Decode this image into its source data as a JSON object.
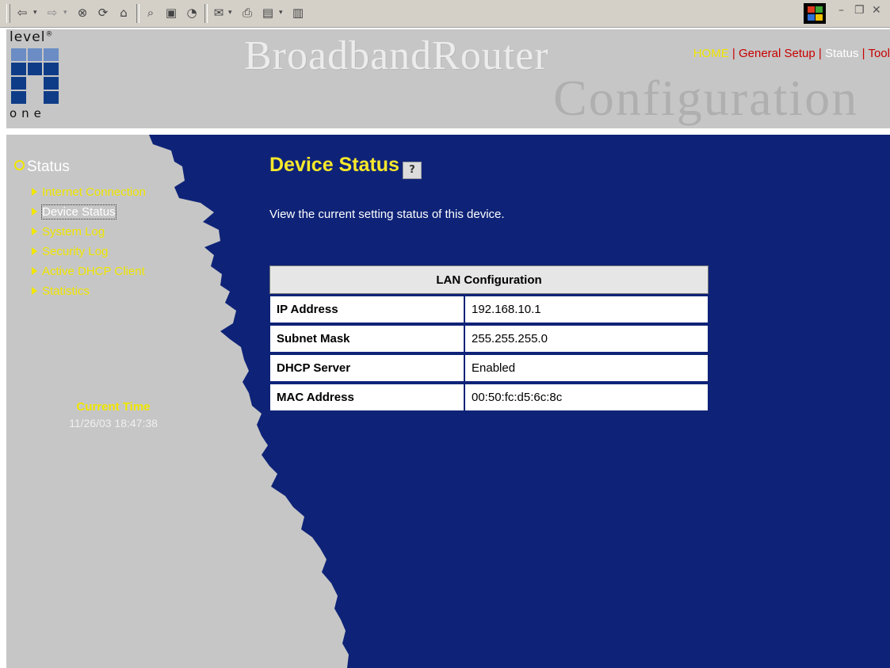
{
  "header": {
    "title_word": "BroadbandRouter",
    "bg_word": "Configuration",
    "logo_top": "level",
    "logo_mark": "®",
    "logo_bottom": "one",
    "nav": [
      {
        "label": "HOME",
        "color": "#f0e600"
      },
      {
        "label": "General Setup",
        "color": "#c80000"
      },
      {
        "label": "Status",
        "color": "#ffffff"
      },
      {
        "label": "Tool",
        "color": "#c80000"
      }
    ],
    "nav_sep": "|"
  },
  "sidebar": {
    "title": "Status",
    "items": [
      {
        "label": "Internet Connection"
      },
      {
        "label": "Device Status",
        "active": true
      },
      {
        "label": "System Log"
      },
      {
        "label": "Security Log"
      },
      {
        "label": "Active DHCP Client"
      },
      {
        "label": "Statistics"
      }
    ],
    "time_label": "Current Time",
    "time_value": "11/26/03 18:47:38"
  },
  "content": {
    "title": "Device Status",
    "help_icon": "?",
    "description": "View the current setting status of this device.",
    "table": {
      "header": "LAN Configuration",
      "rows": [
        {
          "label": "IP Address",
          "value": "192.168.10.1"
        },
        {
          "label": "Subnet Mask",
          "value": "255.255.255.0"
        },
        {
          "label": "DHCP Server",
          "value": "Enabled"
        },
        {
          "label": "MAC Address",
          "value": "00:50:fc:d5:6c:8c"
        }
      ]
    }
  },
  "colors": {
    "background_blue": "#0e2378",
    "sidebar_gray": "#c6c6c6",
    "accent_yellow": "#f0e600",
    "title_yellow": "#f7e82b",
    "link_red": "#c80000"
  },
  "toolbar": {
    "icons": [
      "back-icon",
      "forward-icon",
      "stop-icon",
      "refresh-icon",
      "home-icon",
      "search-icon",
      "favorites-icon",
      "history-icon",
      "mail-icon",
      "print-icon",
      "edit-icon",
      "discuss-icon"
    ]
  }
}
